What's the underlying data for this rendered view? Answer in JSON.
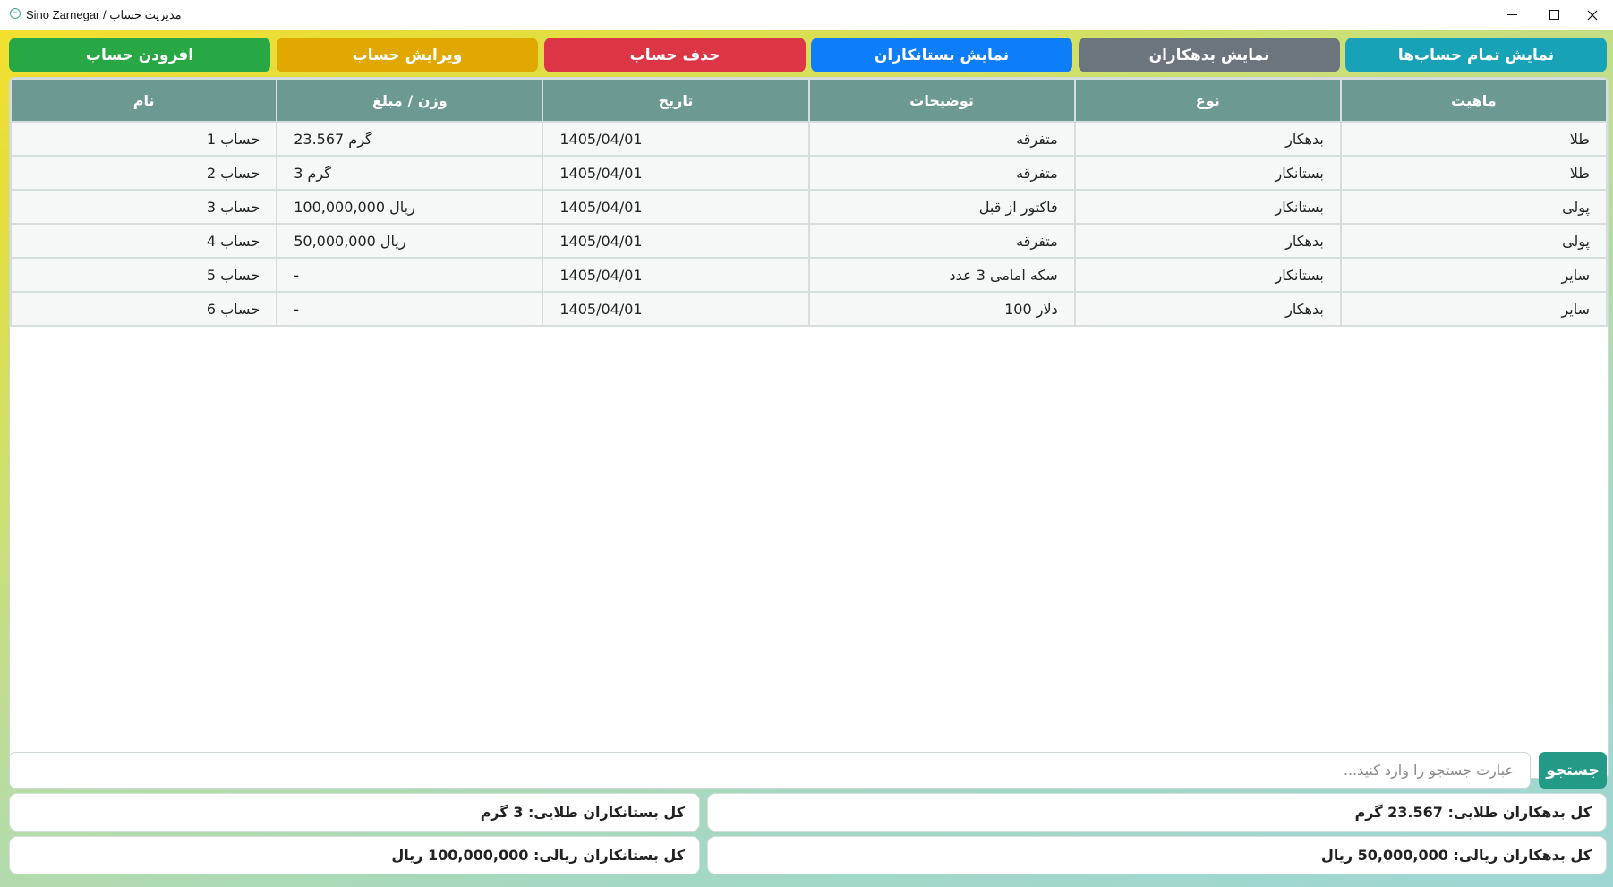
{
  "window": {
    "title": "Sino Zarnegar / مدیریت حساب",
    "controls": {
      "minimize": "—",
      "maximize": "☐",
      "close": "✕"
    }
  },
  "colors": {
    "show_all": "#17a2b8",
    "show_debtors": "#6c757d",
    "show_creditors": "#0d7df9",
    "delete": "#dc3545",
    "edit": "#e0a800",
    "add": "#28a745",
    "table_header": "#6c9a93",
    "search_button": "#239a85"
  },
  "toolbar": {
    "show_all": "نمایش تمام حساب‌ها",
    "show_debtors": "نمایش بدهکاران",
    "show_creditors": "نمایش بستانکاران",
    "delete": "حذف حساب",
    "edit": "ویرایش حساب",
    "add": "افزودن حساب"
  },
  "table": {
    "columns": [
      "ماهیت",
      "نوع",
      "توضیحات",
      "تاریخ",
      "وزن / مبلغ",
      "نام"
    ],
    "rows": [
      [
        "طلا",
        "بدهکار",
        "متفرقه",
        "1405/04/01",
        "23.567 گرم",
        "حساب 1"
      ],
      [
        "طلا",
        "بستانکار",
        "متفرقه",
        "1405/04/01",
        "3 گرم",
        "حساب 2"
      ],
      [
        "پولی",
        "بستانکار",
        "فاکتور از قبل",
        "1405/04/01",
        "100,000,000 ریال",
        "حساب 3"
      ],
      [
        "پولی",
        "بدهکار",
        "متفرقه",
        "1405/04/01",
        "50,000,000 ریال",
        "حساب 4"
      ],
      [
        "سایر",
        "بستانکار",
        "سکه امامی 3 عدد",
        "1405/04/01",
        "-",
        "حساب 5"
      ],
      [
        "سایر",
        "بدهکار",
        "دلار 100",
        "1405/04/01",
        "-",
        "حساب 6"
      ]
    ]
  },
  "search": {
    "placeholder": "عبارت جستجو را وارد کنید...",
    "value": "",
    "button": "جستجو"
  },
  "summary": {
    "gold_debtors": "کل بدهکاران طلایی: 23.567 گرم",
    "gold_creditors": "کل بستانکاران طلایی: 3 گرم",
    "rial_debtors": "کل بدهکاران ریالی: 50,000,000 ریال",
    "rial_creditors": "کل بستانکاران ریالی: 100,000,000 ریال"
  }
}
